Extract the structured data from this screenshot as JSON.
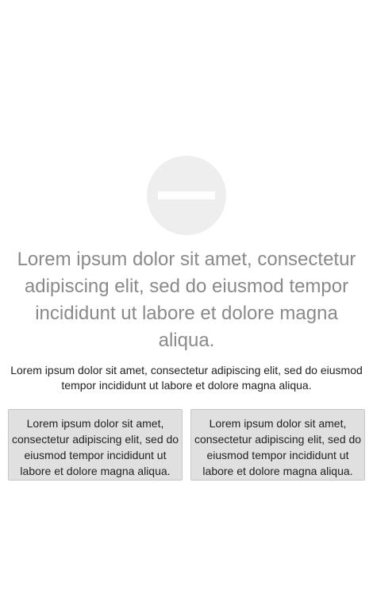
{
  "empty_state": {
    "icon": "minus-circle-icon",
    "colors": {
      "icon_background": "#eeeeee",
      "icon_bar": "#ffffff",
      "headline_text": "#8a8a8a",
      "button_background": "#e0e0e0"
    },
    "headline": "Lorem ipsum dolor sit amet, consectetur adipiscing elit, sed do eiusmod tempor incididunt ut labore et dolore magna aliqua.",
    "description": "Lorem ipsum dolor sit amet, consectetur adipiscing elit, sed do eiusmod tempor incididunt ut labore et dolore magna aliqua.",
    "buttons": [
      {
        "label": "Lorem ipsum dolor sit amet, consectetur adipiscing elit, sed do eiusmod tempor incididunt ut labore et dolore magna aliqua."
      },
      {
        "label": "Lorem ipsum dolor sit amet, consectetur adipiscing elit, sed do eiusmod tempor incididunt ut labore et dolore magna aliqua."
      }
    ]
  }
}
